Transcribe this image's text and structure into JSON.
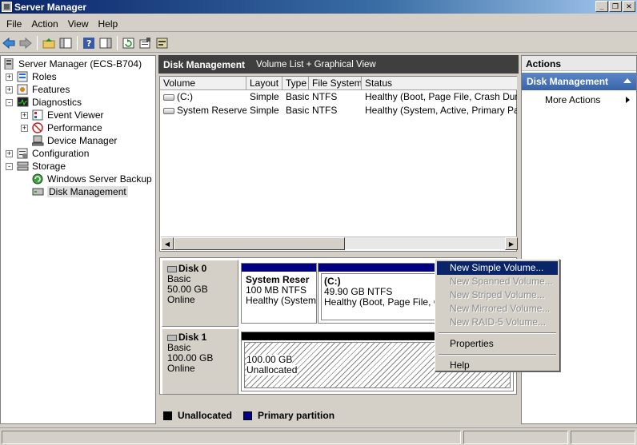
{
  "window": {
    "title": "Server Manager",
    "controls": [
      "_",
      "❐",
      "✕"
    ]
  },
  "menu": [
    "File",
    "Action",
    "View",
    "Help"
  ],
  "toolbar": [
    "back-icon",
    "forward-icon",
    "up-folder-icon",
    "show-hide-tree-icon",
    "help-icon",
    "show-hide-action-pane-icon",
    "refresh-icon",
    "properties-icon",
    "disk-wizard-icon"
  ],
  "tree": {
    "root": "Server Manager (ECS-B704)",
    "roles": "Roles",
    "features": "Features",
    "diagnostics": "Diagnostics",
    "event_viewer": "Event Viewer",
    "performance": "Performance",
    "device_manager": "Device Manager",
    "configuration": "Configuration",
    "storage": "Storage",
    "backup": "Windows Server Backup",
    "disk_mgmt": "Disk Management",
    "plus": "+",
    "minus": "-"
  },
  "center": {
    "title": "Disk Management",
    "subtitle": "Volume List + Graphical View",
    "columns": [
      "Volume",
      "Layout",
      "Type",
      "File System",
      "Status"
    ],
    "volumes": [
      [
        "(C:)",
        "Simple",
        "Basic",
        "NTFS",
        "Healthy (Boot, Page File, Crash Dump,"
      ],
      [
        "System Reserved",
        "Simple",
        "Basic",
        "NTFS",
        "Healthy (System, Active, Primary Parti"
      ]
    ]
  },
  "disks": {
    "disk0": {
      "name": "Disk 0",
      "type": "Basic",
      "size": "50.00 GB",
      "state": "Online",
      "partitions": [
        {
          "title": "System Reser",
          "size": "100 MB NTFS",
          "status": "Healthy (System,"
        },
        {
          "title": "(C:)",
          "size": "49.90 GB NTFS",
          "status": "Healthy (Boot, Page File, Cra"
        }
      ]
    },
    "disk1": {
      "name": "Disk 1",
      "type": "Basic",
      "size": "100.00 GB",
      "state": "Online",
      "unalloc_size": "100.00 GB",
      "unalloc_label": "Unallocated"
    }
  },
  "legend": {
    "unallocated": "Unallocated",
    "primary": "Primary partition",
    "unalloc_color": "#000000",
    "primary_color": "#000080"
  },
  "actions": {
    "header": "Actions",
    "section": "Disk Management",
    "more": "More Actions"
  },
  "context_menu": {
    "new_simple": "New Simple Volume...",
    "new_spanned": "New Spanned Volume...",
    "new_striped": "New Striped Volume...",
    "new_mirrored": "New Mirrored Volume...",
    "new_raid5": "New RAID-5 Volume...",
    "properties": "Properties",
    "help": "Help"
  }
}
